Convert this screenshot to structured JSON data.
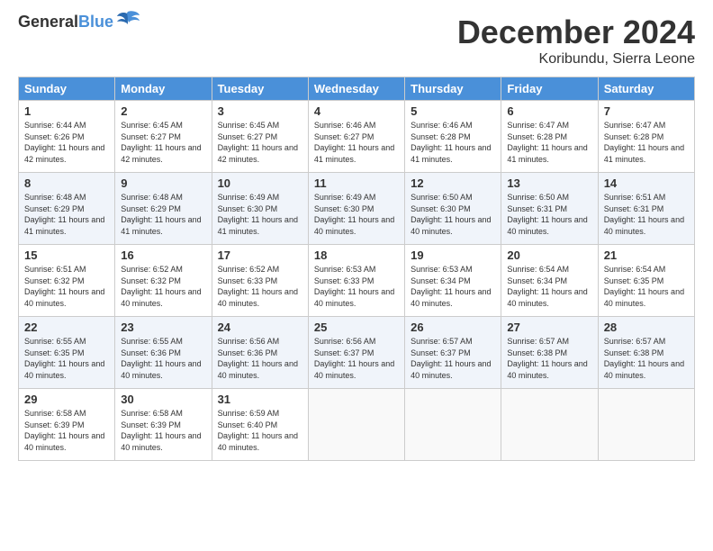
{
  "header": {
    "logo_line1": "General",
    "logo_line2": "Blue",
    "month": "December 2024",
    "location": "Koribundu, Sierra Leone"
  },
  "weekdays": [
    "Sunday",
    "Monday",
    "Tuesday",
    "Wednesday",
    "Thursday",
    "Friday",
    "Saturday"
  ],
  "weeks": [
    [
      {
        "day": "1",
        "rise": "6:44 AM",
        "set": "6:26 PM",
        "daylight": "11 hours and 42 minutes."
      },
      {
        "day": "2",
        "rise": "6:45 AM",
        "set": "6:27 PM",
        "daylight": "11 hours and 42 minutes."
      },
      {
        "day": "3",
        "rise": "6:45 AM",
        "set": "6:27 PM",
        "daylight": "11 hours and 42 minutes."
      },
      {
        "day": "4",
        "rise": "6:46 AM",
        "set": "6:27 PM",
        "daylight": "11 hours and 41 minutes."
      },
      {
        "day": "5",
        "rise": "6:46 AM",
        "set": "6:28 PM",
        "daylight": "11 hours and 41 minutes."
      },
      {
        "day": "6",
        "rise": "6:47 AM",
        "set": "6:28 PM",
        "daylight": "11 hours and 41 minutes."
      },
      {
        "day": "7",
        "rise": "6:47 AM",
        "set": "6:28 PM",
        "daylight": "11 hours and 41 minutes."
      }
    ],
    [
      {
        "day": "8",
        "rise": "6:48 AM",
        "set": "6:29 PM",
        "daylight": "11 hours and 41 minutes."
      },
      {
        "day": "9",
        "rise": "6:48 AM",
        "set": "6:29 PM",
        "daylight": "11 hours and 41 minutes."
      },
      {
        "day": "10",
        "rise": "6:49 AM",
        "set": "6:30 PM",
        "daylight": "11 hours and 41 minutes."
      },
      {
        "day": "11",
        "rise": "6:49 AM",
        "set": "6:30 PM",
        "daylight": "11 hours and 40 minutes."
      },
      {
        "day": "12",
        "rise": "6:50 AM",
        "set": "6:30 PM",
        "daylight": "11 hours and 40 minutes."
      },
      {
        "day": "13",
        "rise": "6:50 AM",
        "set": "6:31 PM",
        "daylight": "11 hours and 40 minutes."
      },
      {
        "day": "14",
        "rise": "6:51 AM",
        "set": "6:31 PM",
        "daylight": "11 hours and 40 minutes."
      }
    ],
    [
      {
        "day": "15",
        "rise": "6:51 AM",
        "set": "6:32 PM",
        "daylight": "11 hours and 40 minutes."
      },
      {
        "day": "16",
        "rise": "6:52 AM",
        "set": "6:32 PM",
        "daylight": "11 hours and 40 minutes."
      },
      {
        "day": "17",
        "rise": "6:52 AM",
        "set": "6:33 PM",
        "daylight": "11 hours and 40 minutes."
      },
      {
        "day": "18",
        "rise": "6:53 AM",
        "set": "6:33 PM",
        "daylight": "11 hours and 40 minutes."
      },
      {
        "day": "19",
        "rise": "6:53 AM",
        "set": "6:34 PM",
        "daylight": "11 hours and 40 minutes."
      },
      {
        "day": "20",
        "rise": "6:54 AM",
        "set": "6:34 PM",
        "daylight": "11 hours and 40 minutes."
      },
      {
        "day": "21",
        "rise": "6:54 AM",
        "set": "6:35 PM",
        "daylight": "11 hours and 40 minutes."
      }
    ],
    [
      {
        "day": "22",
        "rise": "6:55 AM",
        "set": "6:35 PM",
        "daylight": "11 hours and 40 minutes."
      },
      {
        "day": "23",
        "rise": "6:55 AM",
        "set": "6:36 PM",
        "daylight": "11 hours and 40 minutes."
      },
      {
        "day": "24",
        "rise": "6:56 AM",
        "set": "6:36 PM",
        "daylight": "11 hours and 40 minutes."
      },
      {
        "day": "25",
        "rise": "6:56 AM",
        "set": "6:37 PM",
        "daylight": "11 hours and 40 minutes."
      },
      {
        "day": "26",
        "rise": "6:57 AM",
        "set": "6:37 PM",
        "daylight": "11 hours and 40 minutes."
      },
      {
        "day": "27",
        "rise": "6:57 AM",
        "set": "6:38 PM",
        "daylight": "11 hours and 40 minutes."
      },
      {
        "day": "28",
        "rise": "6:57 AM",
        "set": "6:38 PM",
        "daylight": "11 hours and 40 minutes."
      }
    ],
    [
      {
        "day": "29",
        "rise": "6:58 AM",
        "set": "6:39 PM",
        "daylight": "11 hours and 40 minutes."
      },
      {
        "day": "30",
        "rise": "6:58 AM",
        "set": "6:39 PM",
        "daylight": "11 hours and 40 minutes."
      },
      {
        "day": "31",
        "rise": "6:59 AM",
        "set": "6:40 PM",
        "daylight": "11 hours and 40 minutes."
      },
      null,
      null,
      null,
      null
    ]
  ]
}
